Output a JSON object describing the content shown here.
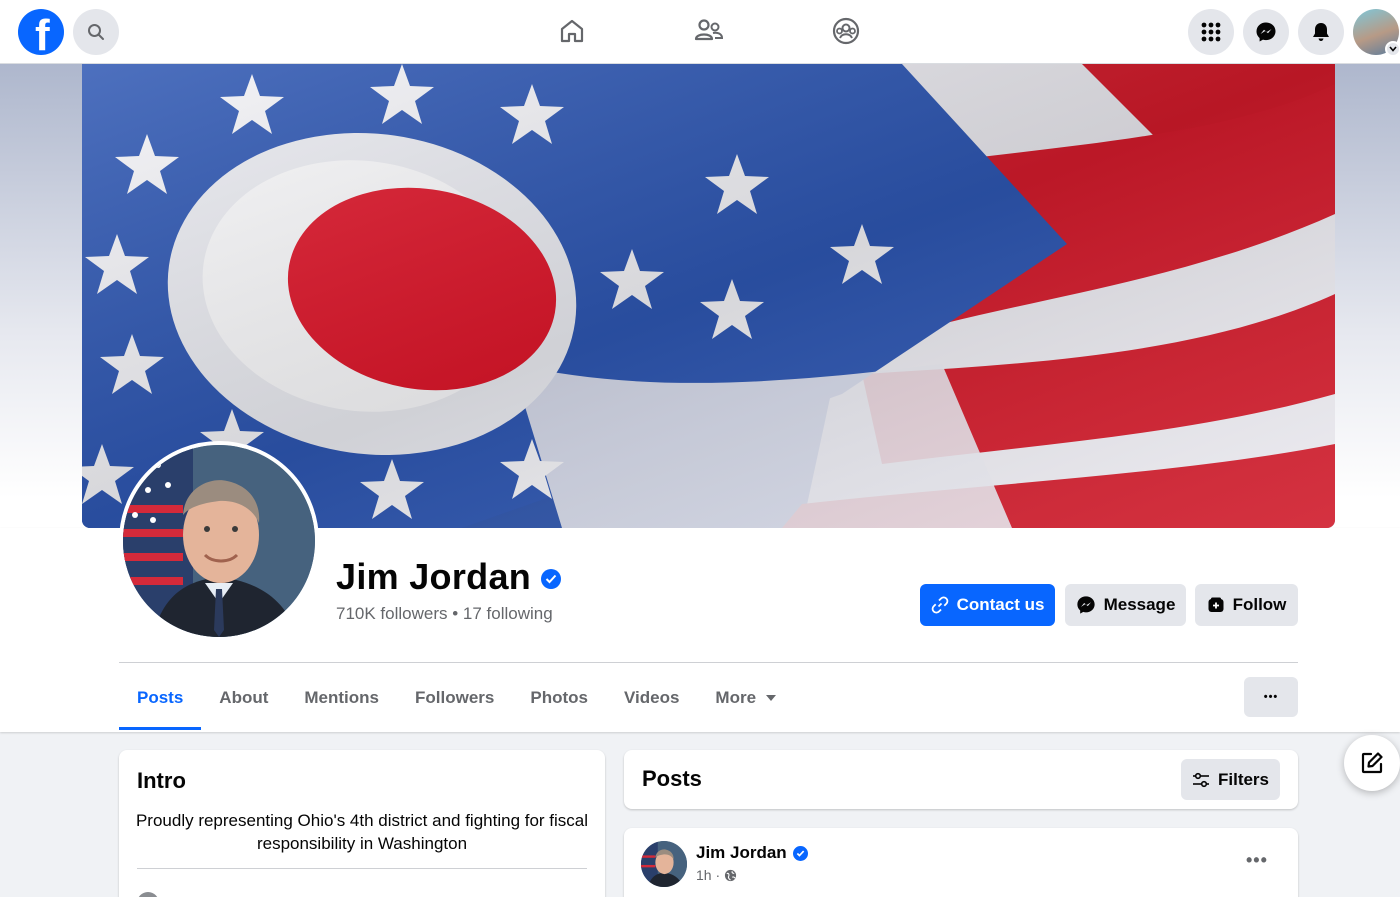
{
  "nav": {
    "logo_letter": "f",
    "icons": [
      "facebook-logo",
      "search-icon",
      "home-icon",
      "friends-icon",
      "groups-icon",
      "menu-grid-icon",
      "messenger-icon",
      "notifications-bell-icon",
      "profile-avatar"
    ]
  },
  "profile": {
    "name": "Jim Jordan",
    "verified": true,
    "stats": "710K followers • 17 following"
  },
  "actions": {
    "contact_label": "Contact us",
    "message_label": "Message",
    "follow_label": "Follow"
  },
  "tabs": [
    {
      "label": "Posts",
      "active": true
    },
    {
      "label": "About"
    },
    {
      "label": "Mentions"
    },
    {
      "label": "Followers"
    },
    {
      "label": "Photos"
    },
    {
      "label": "Videos"
    },
    {
      "label": "More"
    }
  ],
  "more_dots": "•••",
  "intro": {
    "title": "Intro",
    "bio": "Proudly representing Ohio's 4th district and fighting for fiscal responsibility in Washington"
  },
  "posts_section": {
    "title": "Posts",
    "filters_label": "Filters"
  },
  "post": {
    "author": "Jim Jordan",
    "time": "1h ·",
    "dots": "•••"
  },
  "colors": {
    "brand_blue": "#0866ff",
    "secondary_bg": "#e4e6eb",
    "page_bg": "#f0f2f5"
  }
}
